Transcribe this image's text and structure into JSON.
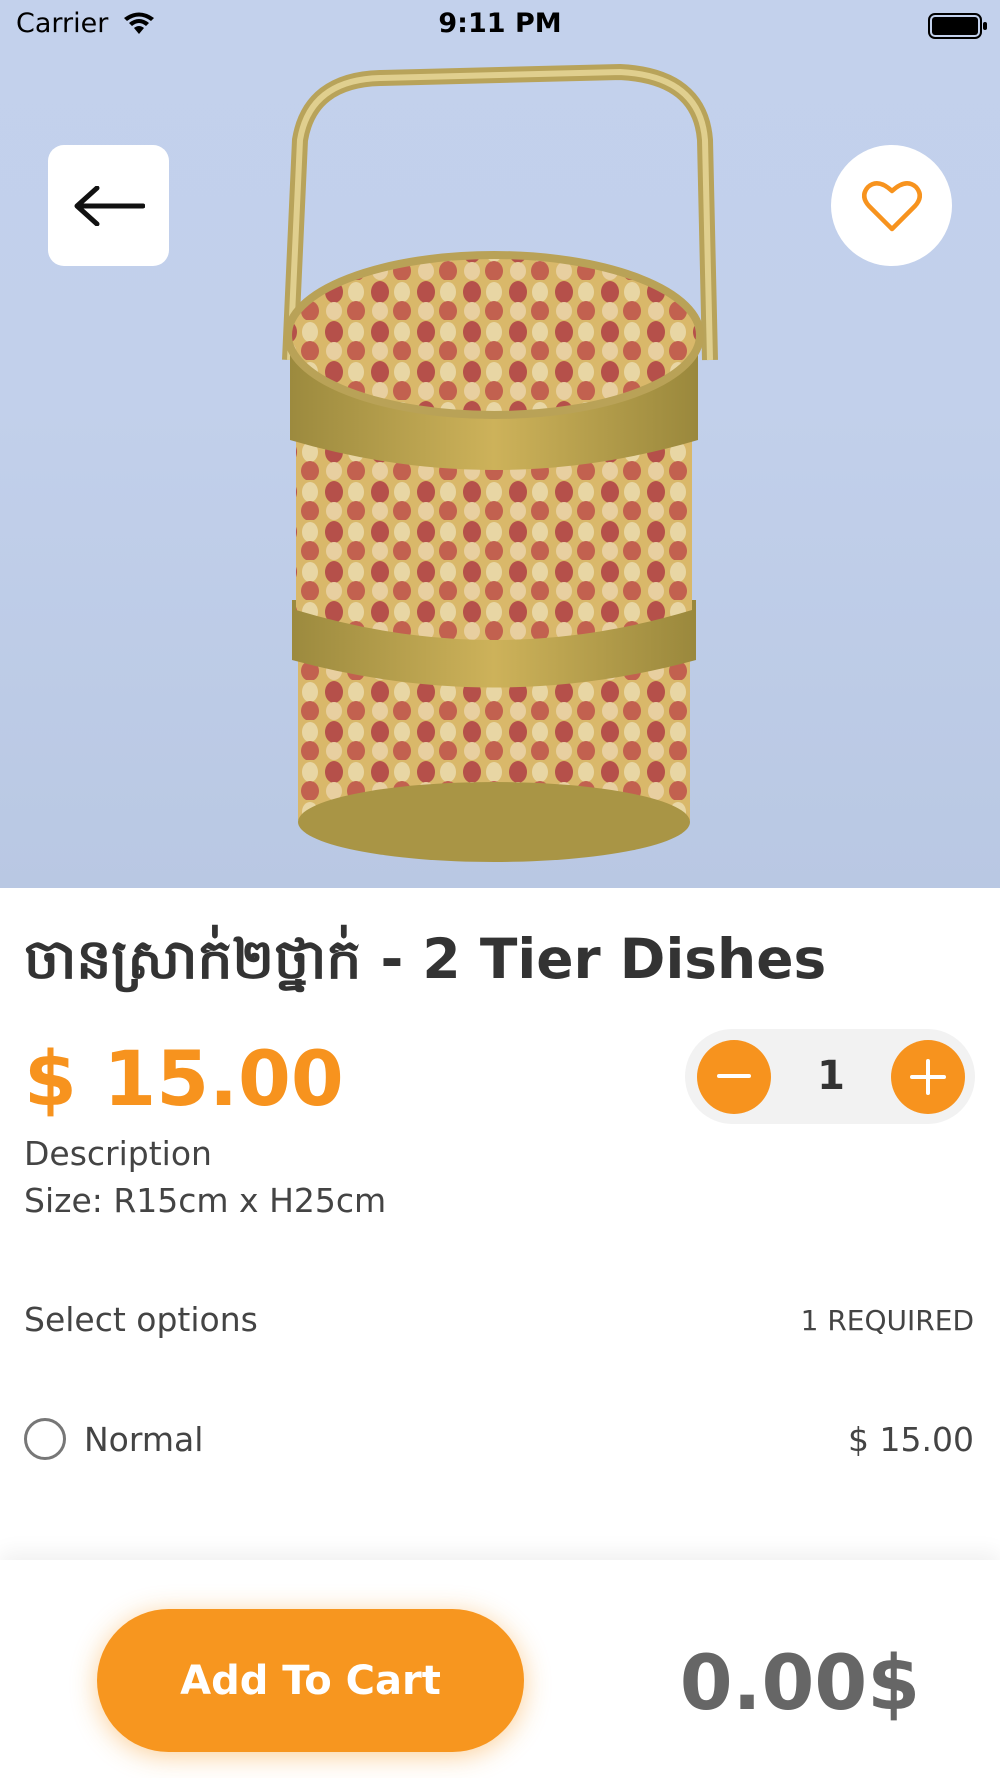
{
  "status_bar": {
    "carrier": "Carrier",
    "time": "9:11 PM"
  },
  "hero": {
    "image": "woven-tiered-food-basket-image",
    "back_icon": "arrow-left-icon",
    "favorite_icon": "heart-outline-icon"
  },
  "product": {
    "title": "ចានស្រាក់២ថ្នាក់ - 2 Tier Dishes",
    "price": "$ 15.00",
    "quantity": "1",
    "description_label": "Description",
    "description": "Size: R15cm x H25cm"
  },
  "options": {
    "label": "Select options",
    "required": "1 REQUIRED",
    "items": [
      {
        "name": "Normal",
        "price": "$ 15.00"
      }
    ]
  },
  "footer": {
    "add_to_cart": "Add To Cart",
    "total": "0.00$"
  },
  "colors": {
    "accent": "#f7931e",
    "hero_bg": "#c3d1ec",
    "text": "#333333"
  }
}
